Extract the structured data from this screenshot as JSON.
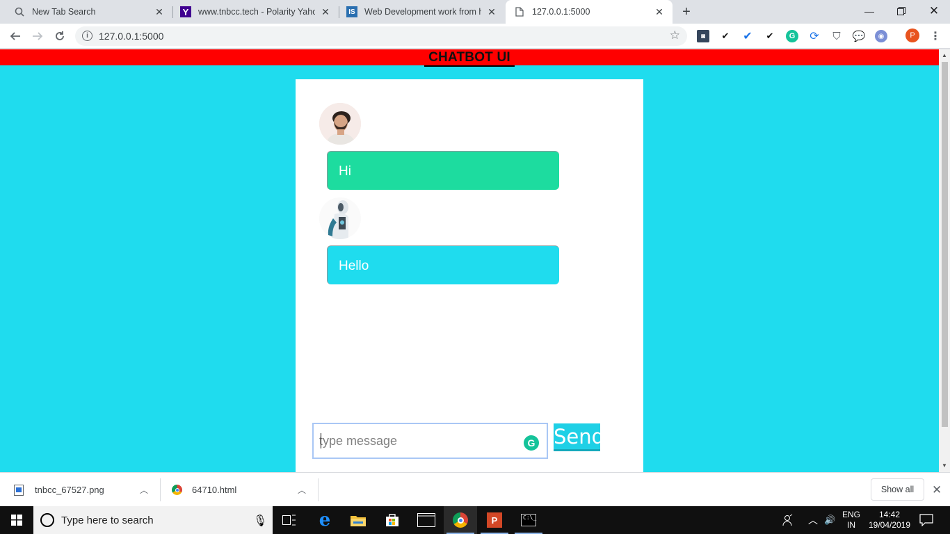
{
  "browser": {
    "tabs": [
      {
        "title": "New Tab Search",
        "icon": "search-icon",
        "active": false
      },
      {
        "title": "www.tnbcc.tech - Polarity Yahoo",
        "icon": "yahoo-icon",
        "active": false
      },
      {
        "title": "Web Development work from ho",
        "icon": "is-icon",
        "active": false
      },
      {
        "title": "127.0.0.1:5000",
        "icon": "page-icon",
        "active": true
      }
    ],
    "url": "127.0.0.1:5000",
    "profile_initial": "P"
  },
  "page": {
    "header_title": "CHATBOT UI",
    "background_color": "#1fdcee",
    "header_color": "#ff0000",
    "messages": [
      {
        "sender": "user",
        "text": "Hi",
        "color": "#1ddc9f"
      },
      {
        "sender": "bot",
        "text": "Hello",
        "color": "#1fdcee"
      }
    ],
    "input_placeholder": "type message",
    "send_label": "Send"
  },
  "downloads": {
    "items": [
      {
        "name": "tnbcc_67527.png"
      },
      {
        "name": "64710.html"
      }
    ],
    "show_all_label": "Show all"
  },
  "taskbar": {
    "search_placeholder": "Type here to search",
    "lang_top": "ENG",
    "lang_bottom": "IN",
    "time": "14:42",
    "date": "19/04/2019"
  }
}
